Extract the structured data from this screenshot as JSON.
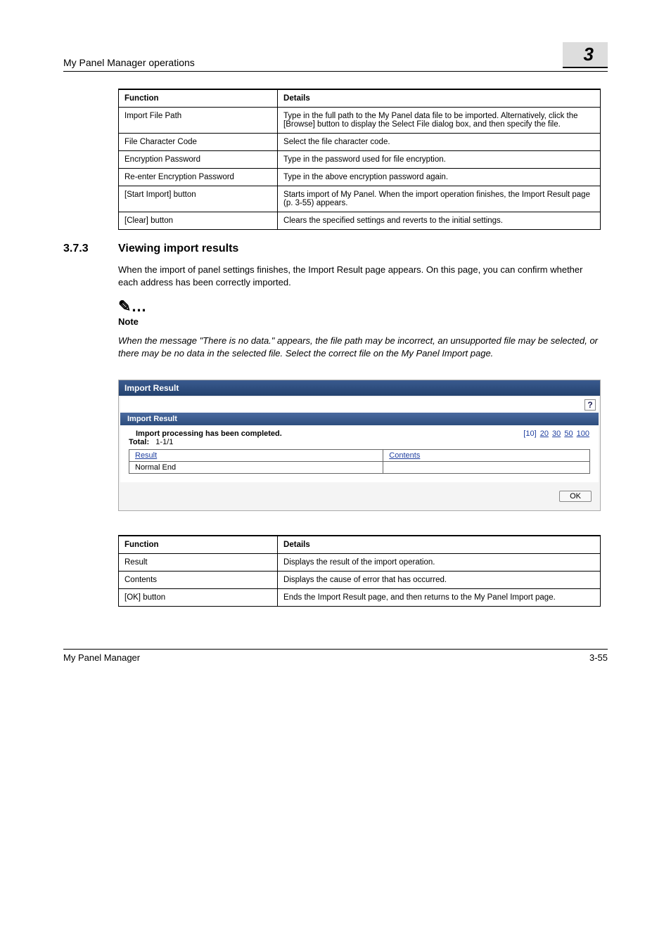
{
  "header": {
    "title": "My Panel Manager operations",
    "chapter": "3"
  },
  "table1": {
    "headers": {
      "func": "Function",
      "det": "Details"
    },
    "rows": [
      {
        "func": "Import File Path",
        "det": "Type in the full path to the My Panel data file to be imported. Alternatively, click the [Browse] button to display the Select File dialog box, and then specify the file."
      },
      {
        "func": "File Character Code",
        "det": "Select the file character code."
      },
      {
        "func": "Encryption Password",
        "det": "Type in the password used for file encryption."
      },
      {
        "func": "Re-enter Encryption Password",
        "det": "Type in the above encryption password again."
      },
      {
        "func": "[Start Import] button",
        "det": "Starts import of My Panel. When the import operation finishes, the Import Result page (p. 3-55) appears."
      },
      {
        "func": "[Clear] button",
        "det": "Clears the specified settings and reverts to the initial settings."
      }
    ]
  },
  "section": {
    "num": "3.7.3",
    "title": "Viewing import results"
  },
  "intro": "When the import of panel settings finishes, the Import Result page appears. On this page, you can confirm whether each address has been correctly imported.",
  "note": {
    "icon": "✎",
    "dots": "…",
    "label": "Note",
    "body": "When the message \"There is no data.\" appears, the file path may be incorrect, an unsupported file may be selected, or there may be no data in the selected file. Select the correct file on the My Panel Import page."
  },
  "screenshot": {
    "title": "Import Result",
    "help": "?",
    "subtitle": "Import Result",
    "msg": "Import processing has been completed.",
    "total_label": "Total:",
    "total_value": "1-1/1",
    "pagesize": [
      "[10]",
      "20",
      "30",
      "50",
      "100"
    ],
    "th": {
      "result": "Result",
      "contents": "Contents"
    },
    "row": {
      "result": "Normal End",
      "contents": ""
    },
    "ok": "OK"
  },
  "table2": {
    "headers": {
      "func": "Function",
      "det": "Details"
    },
    "rows": [
      {
        "func": "Result",
        "det": "Displays the result of the import operation."
      },
      {
        "func": "Contents",
        "det": "Displays the cause of error that has occurred."
      },
      {
        "func": "[OK] button",
        "det": "Ends the Import Result page, and then returns to the My Panel Import page."
      }
    ]
  },
  "footer": {
    "left": "My Panel Manager",
    "right": "3-55"
  }
}
